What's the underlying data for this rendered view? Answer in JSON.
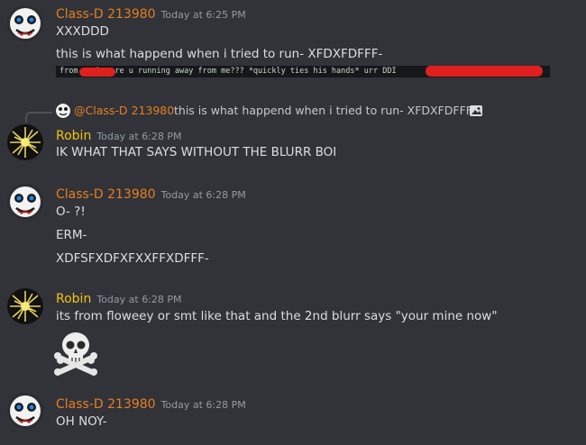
{
  "messages": [
    {
      "author": "Class-D 213980",
      "timestamp": "Today at 6:25 PM",
      "lines": [
        "XXXDDD",
        "this is what happend when i tried to run- XFDXFDFFF-"
      ],
      "attachment_text": "from         : why are u running away from me??? *quickly ties his hands* urr                       DDI"
    },
    {
      "reply": {
        "mention": "@Class-D 213980",
        "text": "this is what happend when i tried to run- XFDXFDFFF-"
      },
      "author": "Robin",
      "timestamp": "Today at 6:28 PM",
      "lines": [
        "IK WHAT THAT SAYS WITHOUT THE BLURR BOI"
      ]
    },
    {
      "author": "Class-D 213980",
      "timestamp": "Today at 6:28 PM",
      "lines": [
        "O- ?!",
        "ERM-",
        "XDFSFXDFXFXXFFXDFFF-"
      ]
    },
    {
      "author": "Robin",
      "timestamp": "Today at 6:28 PM",
      "lines": [
        "its from floweey or smt like that and the 2nd blurr says \"your mine now\""
      ],
      "emoji": "skull-and-crossbones"
    },
    {
      "author": "Class-D 213980",
      "timestamp": "Today at 6:28 PM",
      "lines": [
        "OH NOY-"
      ]
    }
  ],
  "colors": {
    "background": "#313338",
    "classd_name": "#e67e22",
    "robin_name": "#f1c40f",
    "text": "#dbdee1",
    "timestamp": "#949ba4",
    "redaction": "#e0201e"
  }
}
